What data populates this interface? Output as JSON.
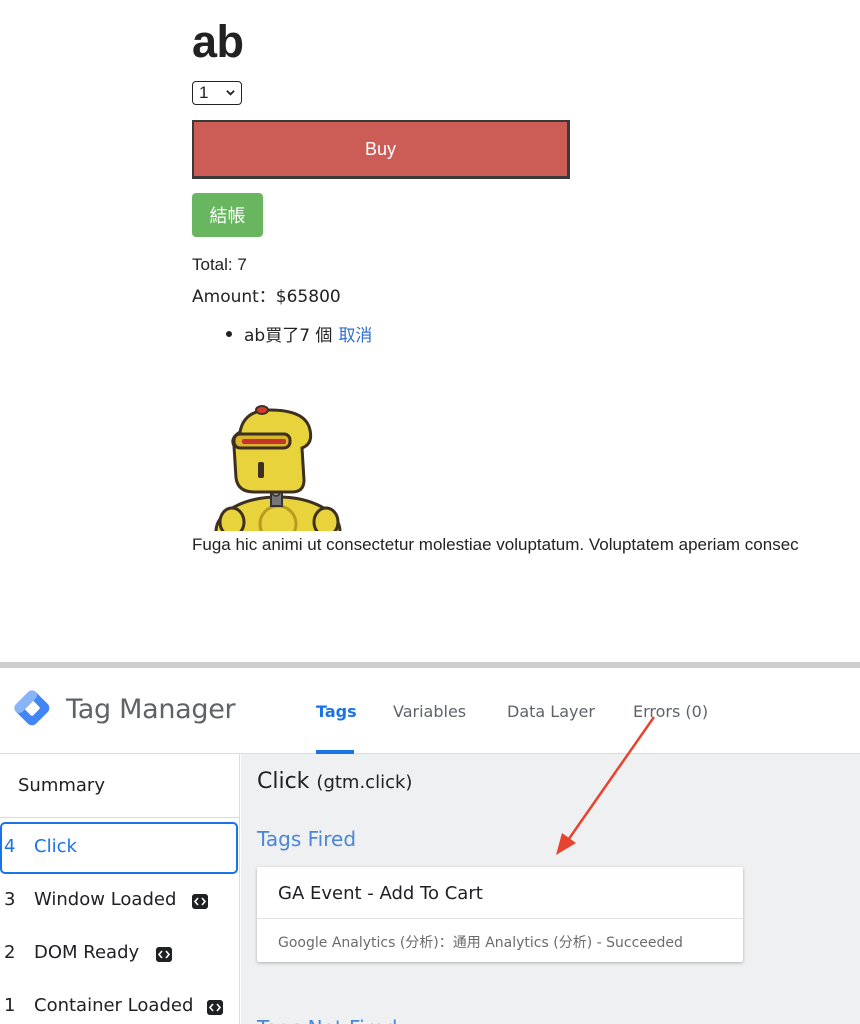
{
  "product": {
    "title": "ab",
    "quantity_selected": "1",
    "buy_label": "Buy",
    "checkout_label": "結帳",
    "total_text": "Total: 7",
    "amount_text": "Amount：$65800",
    "cart_items": [
      {
        "text": "ab買了7 個",
        "cancel_label": "取消"
      }
    ],
    "description": "Fuga hic animi ut consectetur molestiae voluptatum. Voluptatem aperiam consec"
  },
  "tag_manager": {
    "brand": "Tag Manager",
    "tabs": [
      {
        "label": "Tags",
        "active": true
      },
      {
        "label": "Variables",
        "active": false
      },
      {
        "label": "Data Layer",
        "active": false
      },
      {
        "label": "Errors (0)",
        "active": false
      }
    ],
    "sidebar": {
      "summary_label": "Summary",
      "events": [
        {
          "number": "4",
          "label": "Click",
          "selected": true,
          "code_icon": false
        },
        {
          "number": "3",
          "label": "Window Loaded",
          "selected": false,
          "code_icon": true
        },
        {
          "number": "2",
          "label": "DOM Ready",
          "selected": false,
          "code_icon": true
        },
        {
          "number": "1",
          "label": "Container Loaded",
          "selected": false,
          "code_icon": true
        }
      ]
    },
    "main": {
      "event_title": "Click",
      "event_subtitle": "(gtm.click)",
      "tags_fired_heading": "Tags Fired",
      "fired_tag": {
        "name": "GA Event - Add To Cart",
        "detail": "Google Analytics (分析)：通用 Analytics (分析) - Succeeded"
      },
      "tags_not_fired_heading": "Tags Not Fired"
    },
    "colors": {
      "accent": "#1a73e8",
      "buy_button": "#cc5d56",
      "checkout_button": "#68b65f",
      "arrow": "#e8432e"
    }
  }
}
